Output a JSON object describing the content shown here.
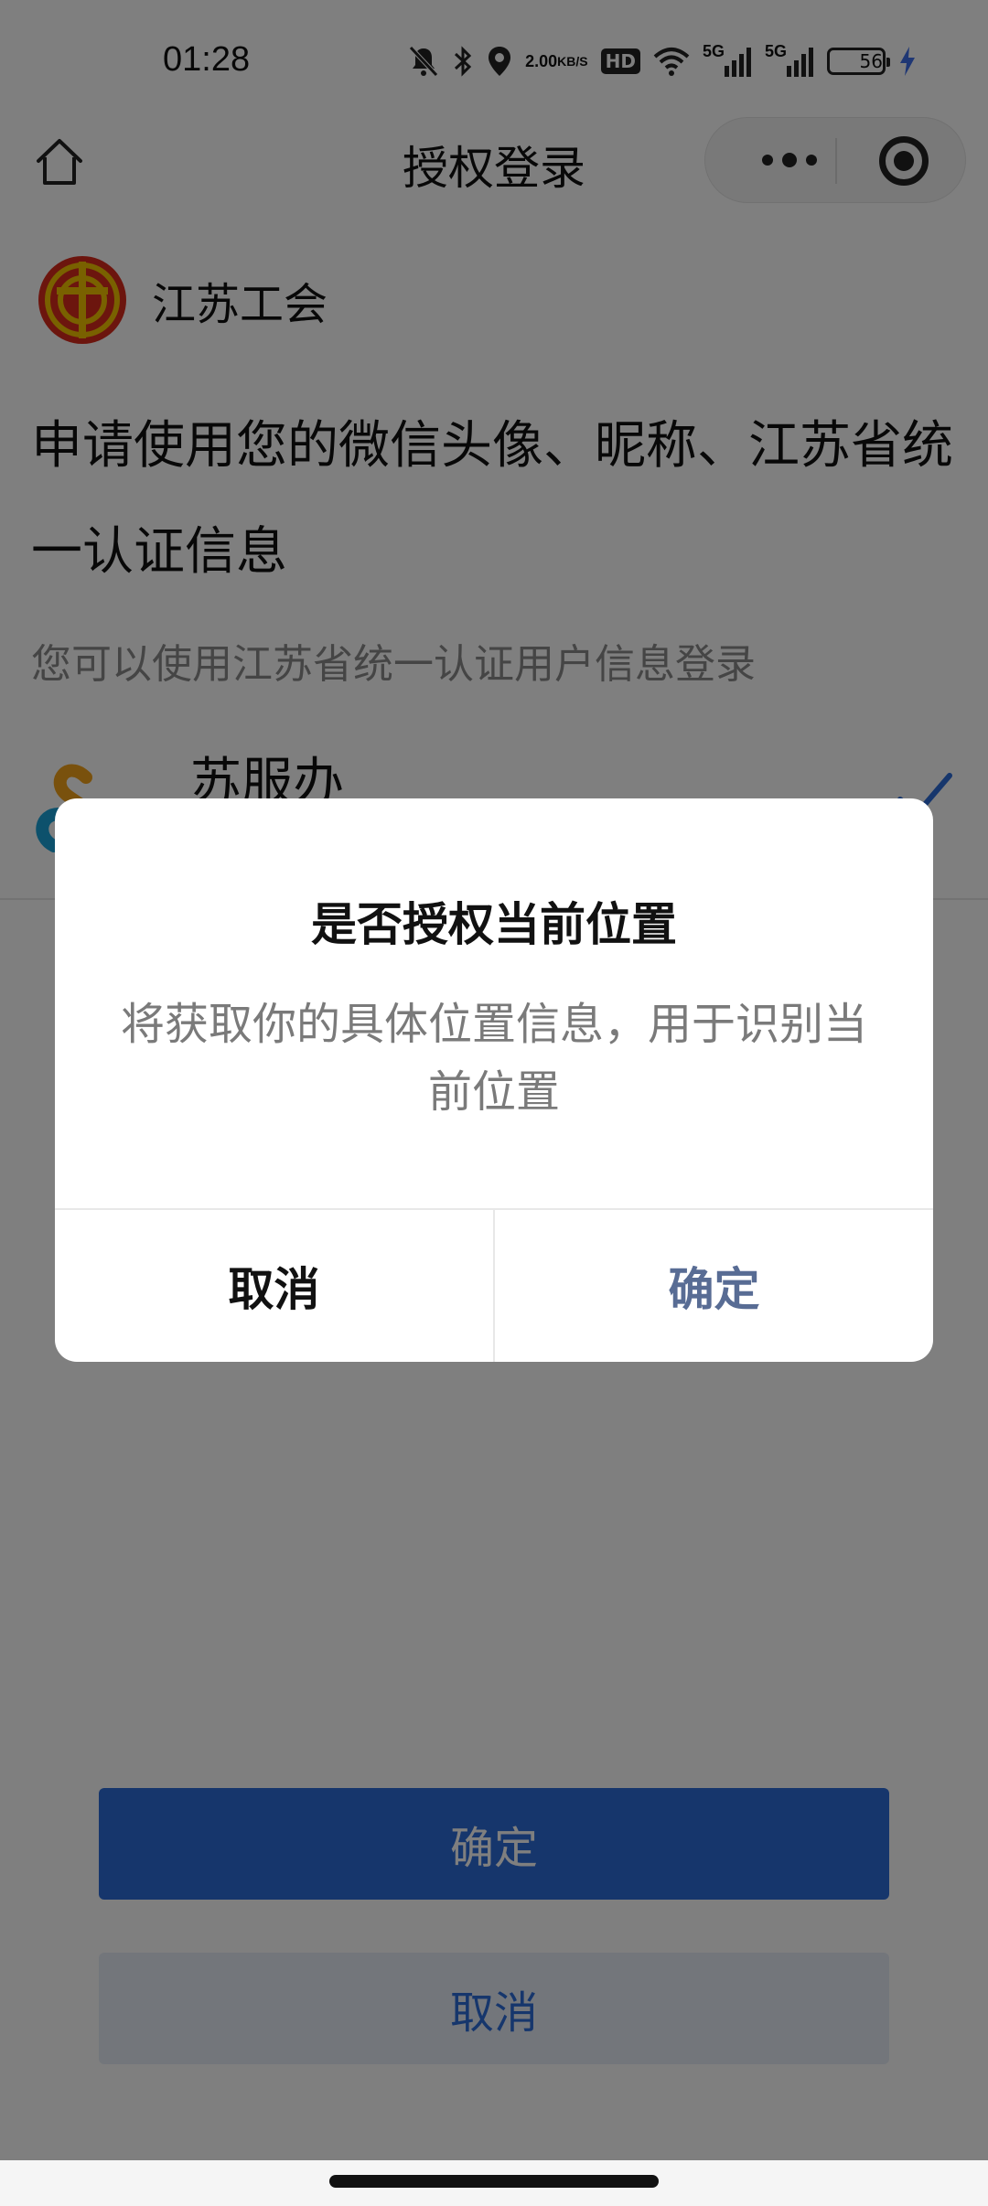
{
  "status_bar": {
    "time": "01:28",
    "net_speed_value": "2.00",
    "net_speed_unit": "KB/S",
    "hd_label": "HD",
    "signal1_label": "5G",
    "signal2_label": "5G",
    "battery_level": "56",
    "icons": [
      "bell-off-icon",
      "bluetooth-icon",
      "location-icon",
      "wifi-icon",
      "signal-icon",
      "battery-icon",
      "charging-icon"
    ]
  },
  "nav": {
    "title": "授权登录",
    "icons": [
      "home-icon",
      "more-icon",
      "close-capsule-icon"
    ]
  },
  "app": {
    "name": "江苏工会"
  },
  "auth": {
    "request_text": "申请使用您的微信头像、昵称、江苏省统一认证信息",
    "hint_text": "您可以使用江苏省统一认证用户信息登录",
    "option_name": "苏服办"
  },
  "buttons": {
    "confirm_label": "确定",
    "cancel_label": "取消"
  },
  "dialog": {
    "title": "是否授权当前位置",
    "body": "将获取你的具体位置信息，用于识别当前位置",
    "cancel_label": "取消",
    "ok_label": "确定"
  },
  "colors": {
    "primary": "#2d6cd9",
    "dialog_ok": "#586c94",
    "mask": "rgba(0,0,0,0.5)"
  }
}
